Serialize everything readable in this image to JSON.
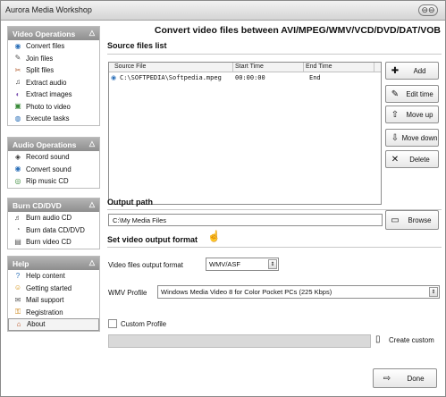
{
  "window": {
    "title": "Aurora Media Workshop",
    "min_glyph": "⊖⊖"
  },
  "sidebar": {
    "panels": [
      {
        "header": "Video Operations",
        "items": [
          {
            "label": "Convert files",
            "icon": "convert-icon"
          },
          {
            "label": "Join files",
            "icon": "join-icon"
          },
          {
            "label": "Split files",
            "icon": "split-icon"
          },
          {
            "label": "Extract audio",
            "icon": "audio-icon"
          },
          {
            "label": "Extract images",
            "icon": "images-icon"
          },
          {
            "label": "Photo to video",
            "icon": "photo-icon"
          },
          {
            "label": "Execute tasks",
            "icon": "tasks-icon"
          }
        ]
      },
      {
        "header": "Audio Operations",
        "items": [
          {
            "label": "Record sound",
            "icon": "record-icon"
          },
          {
            "label": "Convert sound",
            "icon": "convert-sound-icon"
          },
          {
            "label": "Rip music CD",
            "icon": "cd-icon"
          }
        ]
      },
      {
        "header": "Burn CD/DVD",
        "items": [
          {
            "label": "Burn audio CD",
            "icon": "burn-audio-icon"
          },
          {
            "label": "Burn data CD/DVD",
            "icon": "burn-data-icon"
          },
          {
            "label": "Burn video CD",
            "icon": "burn-video-icon"
          }
        ]
      },
      {
        "header": "Help",
        "items": [
          {
            "label": "Help content",
            "icon": "help-icon"
          },
          {
            "label": "Getting started",
            "icon": "start-icon"
          },
          {
            "label": "Mail support",
            "icon": "mail-icon"
          },
          {
            "label": "Registration",
            "icon": "registration-icon"
          },
          {
            "label": "About",
            "icon": "home-icon"
          }
        ]
      }
    ]
  },
  "main": {
    "heading": "Convert video files between AVI/MPEG/WMV/VCD/DVD/DAT/VOB",
    "source_files_label": "Source files list",
    "columns": [
      "Source File",
      "Start Time",
      "End Time"
    ],
    "rows": [
      {
        "file": "C:\\SOFTPEDIA\\Softpedia.mpeg",
        "start": "00:00:00",
        "end": "End"
      }
    ],
    "buttons": {
      "add": "Add",
      "edit_time": "Edit time",
      "move_up": "Move up",
      "move_down": "Move down",
      "delete": "Delete"
    },
    "output_path_label": "Output path",
    "output_path_value": "C:\\My Media Files",
    "browse": "Browse",
    "video_format_label": "Set video output format",
    "format_field_label": "Video files output format",
    "format_value": "WMV/ASF",
    "profile_field_label": "WMV Profile",
    "profile_value": "Windows Media Video 8 for Color Pocket PCs (225 Kbps)",
    "custom_profile_label": "Custom Profile",
    "create_custom": "Create custom",
    "done": "Done"
  }
}
